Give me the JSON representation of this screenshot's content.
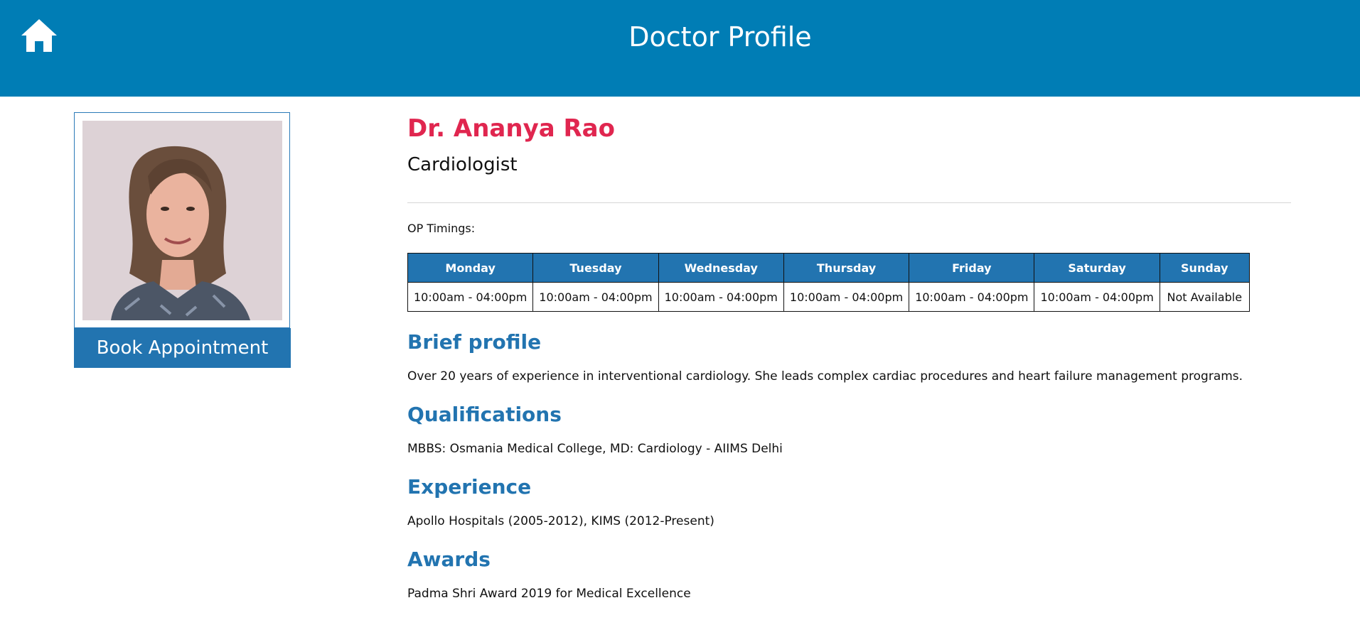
{
  "header": {
    "title": "Doctor Profile",
    "home_icon": "home-icon"
  },
  "sidebar": {
    "photo_alt": "Doctor photo",
    "book_button": "Book Appointment"
  },
  "doctor": {
    "name": "Dr. Ananya Rao",
    "specialty": "Cardiologist"
  },
  "op_timings": {
    "label": "OP Timings:",
    "days": [
      "Monday",
      "Tuesday",
      "Wednesday",
      "Thursday",
      "Friday",
      "Saturday",
      "Sunday"
    ],
    "hours": [
      "10:00am - 04:00pm",
      "10:00am - 04:00pm",
      "10:00am - 04:00pm",
      "10:00am - 04:00pm",
      "10:00am - 04:00pm",
      "10:00am - 04:00pm",
      "Not Available"
    ]
  },
  "sections": {
    "brief_profile": {
      "title": "Brief profile",
      "text": "Over 20 years of experience in interventional cardiology. She leads complex cardiac procedures and heart failure management programs."
    },
    "qualifications": {
      "title": "Qualifications",
      "text": "MBBS: Osmania Medical College, MD: Cardiology - AIIMS Delhi"
    },
    "experience": {
      "title": "Experience",
      "text": "Apollo Hospitals (2005-2012), KIMS (2012-Present)"
    },
    "awards": {
      "title": "Awards",
      "text": "Padma Shri Award 2019 for Medical Excellence"
    }
  },
  "colors": {
    "header_bg": "#007db5",
    "accent_blue": "#2274b0",
    "name_red": "#e0264f"
  }
}
